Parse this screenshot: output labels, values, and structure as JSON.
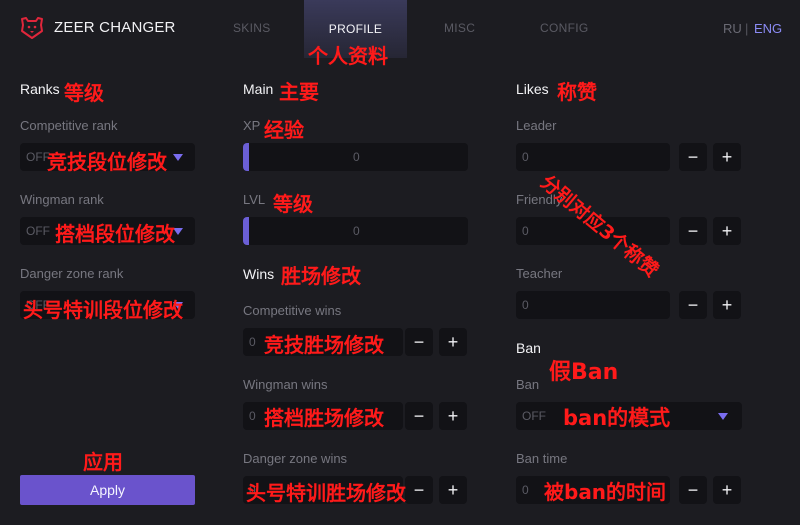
{
  "header": {
    "title": "ZEER CHANGER",
    "tabs": [
      "SKINS",
      "PROFILE",
      "MISC",
      "CONFIG"
    ],
    "lang_ru": "RU",
    "lang_sep": "|",
    "lang_eng": "ENG",
    "accent": "#7a6df0"
  },
  "ranks": {
    "title": "Ranks",
    "competitive_label": "Competitive rank",
    "competitive_value": "OFF",
    "wingman_label": "Wingman rank",
    "wingman_value": "OFF",
    "danger_label": "Danger zone rank",
    "danger_value": "OFF"
  },
  "main": {
    "title": "Main",
    "xp_label": "XP",
    "xp_value": "0",
    "lvl_label": "LVL",
    "lvl_value": "0"
  },
  "wins": {
    "title": "Wins",
    "competitive_label": "Competitive wins",
    "competitive_value": "0",
    "wingman_label": "Wingman wins",
    "wingman_value": "0",
    "danger_label": "Danger zone wins",
    "danger_value": "0"
  },
  "likes": {
    "title": "Likes",
    "leader_label": "Leader",
    "leader_value": "0",
    "friendly_label": "Friendly",
    "friendly_value": "0",
    "teacher_label": "Teacher",
    "teacher_value": "0"
  },
  "ban": {
    "title": "Ban",
    "ban_label": "Ban",
    "ban_value": "OFF",
    "time_label": "Ban time",
    "time_value": "0"
  },
  "buttons": {
    "minus": "−",
    "plus": "+",
    "apply": "Apply"
  },
  "annotations": {
    "profile": "个人资料",
    "ranks": "等级",
    "main": "主要",
    "likes": "称赞",
    "xp": "经验",
    "competitive_rank": "竞技段位修改",
    "lvl": "等级",
    "likes_note": "分别对应3个称赞",
    "wingman_rank": "搭档段位修改",
    "wins": "胜场修改",
    "danger_rank": "头号特训段位修改",
    "competitive_wins": "竞技胜场修改",
    "fake_ban": "假Ban",
    "wingman_wins": "搭档胜场修改",
    "ban_mode": "ban的模式",
    "apply": "应用",
    "danger_wins": "头号特训胜场修改",
    "ban_time": "被ban的时间"
  }
}
